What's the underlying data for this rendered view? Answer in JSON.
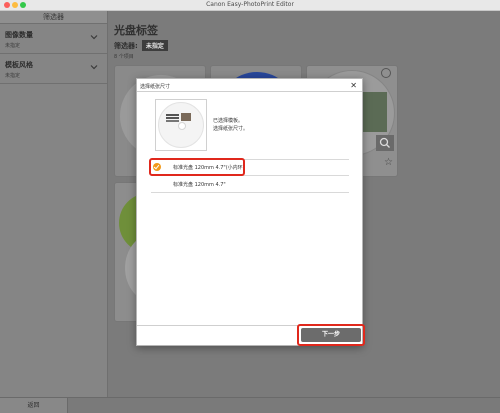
{
  "window": {
    "title": "Canon Easy-PhotoPrint Editor"
  },
  "sidebar": {
    "header": "筛选器",
    "items": [
      {
        "label": "图像数量",
        "value": "未指定"
      },
      {
        "label": "模板风格",
        "value": "未指定"
      }
    ]
  },
  "main": {
    "title": "光盘标签",
    "filter_label": "筛选器:",
    "filter_value": "未指定",
    "count": "8 个项目"
  },
  "dialog": {
    "title": "选择纸张尺寸",
    "message_line1": "已选择模板。",
    "message_line2": "选择纸张尺寸。",
    "options": [
      {
        "label": "标准光盘 120mm 4.7\"(小内环)",
        "selected": true
      },
      {
        "label": "标准光盘 120mm 4.7\"",
        "selected": false
      }
    ],
    "next_label": "下一步"
  },
  "footer": {
    "back_label": "返回"
  },
  "colors": {
    "accent": "#f19a1b",
    "highlight": "#e0281c",
    "button": "#6c6c6c"
  },
  "icons": [
    "chevron-down-icon",
    "close-icon",
    "check-circle-icon",
    "zoom-icon",
    "star-icon",
    "reload-icon"
  ]
}
